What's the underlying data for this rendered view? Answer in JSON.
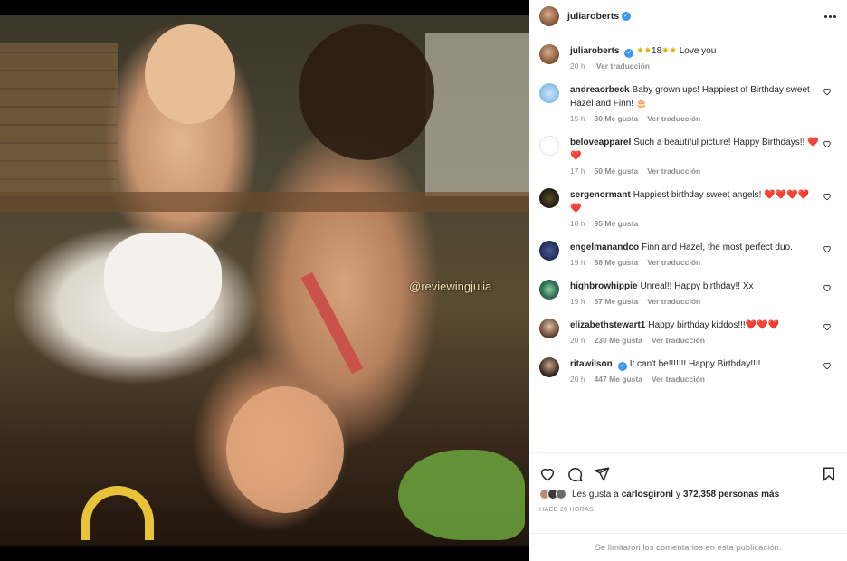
{
  "post": {
    "username": "juliaroberts",
    "watermark": "@reviewingjulia",
    "caption": {
      "username": "juliaroberts",
      "text_prefix": "",
      "star_glyph": "✷",
      "number": "18",
      "text_suffix": "Love you",
      "time": "20 h",
      "translate": "Ver traducción"
    }
  },
  "comments": [
    {
      "username": "andreaorbeck",
      "verified": false,
      "text": "Baby grown ups! Happiest of Birthday sweet Hazel and Finn! 🎂",
      "time": "15 h",
      "likes": "30 Me gusta",
      "translate": "Ver traducción"
    },
    {
      "username": "beloveapparel",
      "verified": false,
      "text": "Such a beautiful picture! Happy Birthdays!! ❤️❤️",
      "time": "17 h",
      "likes": "50 Me gusta",
      "translate": "Ver traducción"
    },
    {
      "username": "sergenormant",
      "verified": false,
      "text": "Happiest birthday sweet angels! ❤️❤️❤️❤️❤️",
      "time": "18 h",
      "likes": "95 Me gusta",
      "translate": "Ver traducción"
    },
    {
      "username": "engelmanandco",
      "verified": false,
      "text": "Finn and Hazel, the most perfect duo.",
      "time": "19 h",
      "likes": "88 Me gusta",
      "translate": "Ver traducción"
    },
    {
      "username": "highbrowhippie",
      "verified": false,
      "text": "Unreal!! Happy birthday!! Xx",
      "time": "19 h",
      "likes": "67 Me gusta",
      "translate": "Ver traducción"
    },
    {
      "username": "elizabethstewart1",
      "verified": false,
      "text": "Happy birthday kiddos!!!❤️❤️❤️",
      "time": "20 h",
      "likes": "230 Me gusta",
      "translate": "Ver traducción"
    },
    {
      "username": "ritawilson",
      "verified": true,
      "text": "It can't be!!!!!!! Happy Birthday!!!!",
      "time": "20 h",
      "likes": "447 Me gusta",
      "translate": "Ver traducción"
    }
  ],
  "likes_summary": {
    "prefix": "Les gusta a",
    "user": "carlosgironl",
    "middle": "y",
    "count": "372,358 personas más"
  },
  "time_ago": "HACE 20 HORAS",
  "comments_limited": "Se limitaron los comentarios en esta publicación.",
  "icons": {
    "like": "heart-outline-icon",
    "comment": "comment-bubble-icon",
    "share": "paper-plane-icon",
    "save": "bookmark-icon",
    "more": "more-dots-icon",
    "verified": "verified-badge-icon"
  },
  "colors": {
    "verified": "#3897f0",
    "heart": "#ed1c24",
    "muted_text": "#8e8e8e"
  }
}
